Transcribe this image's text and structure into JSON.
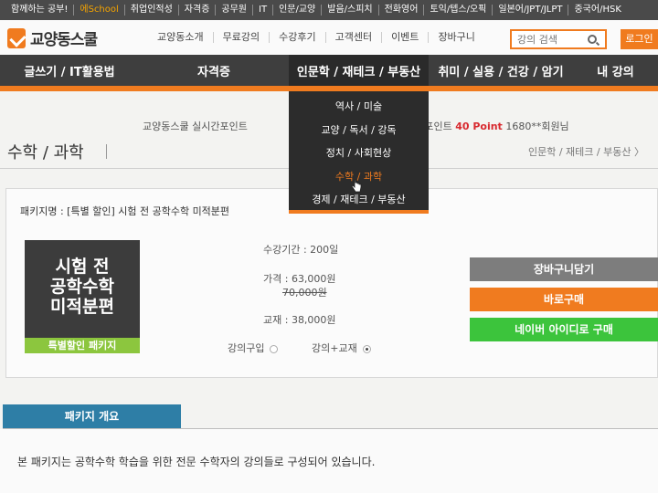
{
  "top_strip": [
    "함께하는 공부!",
    "에School",
    "취업인적성",
    "자격증",
    "공무원",
    "IT",
    "인문/교양",
    "발음/스피치",
    "전화영어",
    "토익/텝스/오픽",
    "일본어/JPT/JLPT",
    "중국어/HSK"
  ],
  "header": {
    "logo": "교양동스쿨",
    "nav": [
      "교양동소개",
      "무료강의",
      "수강후기",
      "고객센터",
      "이벤트",
      "장바구니"
    ],
    "search_placeholder": "강의 검색",
    "login": "로그인"
  },
  "gnb": [
    "글쓰기 / IT활용법",
    "자격증",
    "인문학 / 재테크 / 부동산",
    "취미 / 실용 / 건강 / 암기",
    "내 강의"
  ],
  "dropdown": [
    "역사 / 미술",
    "교양 / 독서 / 강독",
    "정치 / 사회현상",
    "수학 / 과학",
    "경제 / 재테크 / 부동산"
  ],
  "banner": {
    "left": "교양동스쿨 실시간포인트",
    "mid": "포인트",
    "points": "40 Point",
    "right": "1680**회원님"
  },
  "section": {
    "title": "수학 / 과학",
    "breadcrumb": "인문학 / 재테크 / 부동산 〉"
  },
  "product": {
    "package_name": "패키지명 : [특별 할인] 시험 전 공학수학 미적분편",
    "thumb_lines": [
      "시험 전",
      "공학수학",
      "미적분편"
    ],
    "thumb_badge": "특별할인 패키지",
    "period": "수강기간 : 200일",
    "price": "가격 : 63,000원",
    "original_price": "70,000원",
    "textbook": "교재 : 38,000원",
    "option_lecture": "강의구입",
    "option_lecture_text": "강의+교재",
    "buttons": {
      "cart": "장바구니담기",
      "buy": "바로구매",
      "naver": "네이버 아이디로 구매"
    }
  },
  "overview": {
    "tab": "패키지 개요",
    "text": "본 패키지는 공학수학 학습을 위한 전문 수학자의 강의들로 구성되어 있습니다."
  },
  "colors": {
    "accent": "#f07b1f",
    "nav_dark": "#3e3e3e",
    "naver_green": "#3cc43c",
    "tab_blue": "#2e7ea6",
    "badge_green": "#8cc63e"
  }
}
